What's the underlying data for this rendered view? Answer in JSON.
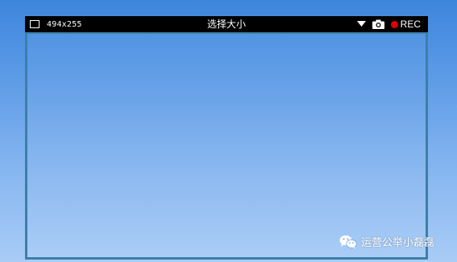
{
  "recorder": {
    "size_label": "494x255",
    "title": "选择大小",
    "icons": {
      "window": "window-icon",
      "dropdown": "triangle-down-icon",
      "camera": "camera-icon",
      "record": "record-dot-icon"
    },
    "rec_label": "REC"
  },
  "watermark": {
    "text": "运营公举小磊磊",
    "icon": "wechat-icon"
  },
  "colors": {
    "toolbar_bg": "#000000",
    "frame_border": "#3c7fa8",
    "rec_dot": "#e00000",
    "background_top": "#3d86dd",
    "background_bottom": "#a9ccf6"
  }
}
